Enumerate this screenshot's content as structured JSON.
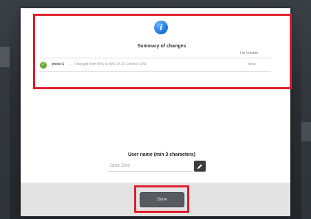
{
  "summary": {
    "title": "Summary of changes",
    "lot_number_header": "Lot Number"
  },
  "changes": [
    {
      "status": "check-icon",
      "name": "photo 6",
      "separator": "–",
      "description": "Changed from 90% to 80% 18-20 Ethanol / IPA",
      "lot": "None"
    }
  ],
  "user": {
    "label": "User name (min 3 characters)",
    "placeholder": "Jane Doe",
    "value": ""
  },
  "actions": {
    "done_label": "Done"
  },
  "colors": {
    "highlight": "#e01a2a",
    "info_icon": "#1f7ae0",
    "success": "#6aa938",
    "done_button": "#575b60"
  }
}
